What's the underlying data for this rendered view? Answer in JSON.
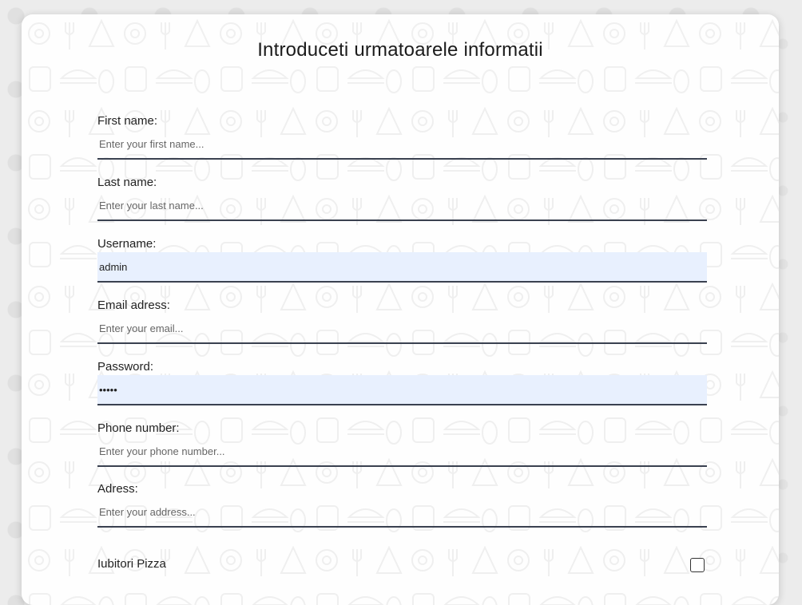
{
  "form": {
    "title": "Introduceti urmatoarele informatii",
    "fields": [
      {
        "label": "First name:",
        "value": "",
        "placeholder": "Enter your first name...",
        "type": "text"
      },
      {
        "label": "Last name:",
        "value": "",
        "placeholder": "Enter your last name...",
        "type": "text"
      },
      {
        "label": "Username:",
        "value": "admin",
        "placeholder": "",
        "type": "text"
      },
      {
        "label": "Email adress:",
        "value": "",
        "placeholder": "Enter your email...",
        "type": "email"
      },
      {
        "label": "Password:",
        "value": "•••••",
        "placeholder": "",
        "type": "password"
      },
      {
        "label": "Phone number:",
        "value": "",
        "placeholder": "Enter your phone number...",
        "type": "text"
      },
      {
        "label": "Adress:",
        "value": "",
        "placeholder": "Enter your address...",
        "type": "text"
      }
    ],
    "checkbox": {
      "label": "Iubitori Pizza",
      "checked": false
    }
  },
  "colors": {
    "autofill_bg": "#e8f0fe",
    "underline": "#3a4150",
    "card_bg": "#ffffff",
    "page_bg": "#ececec"
  }
}
